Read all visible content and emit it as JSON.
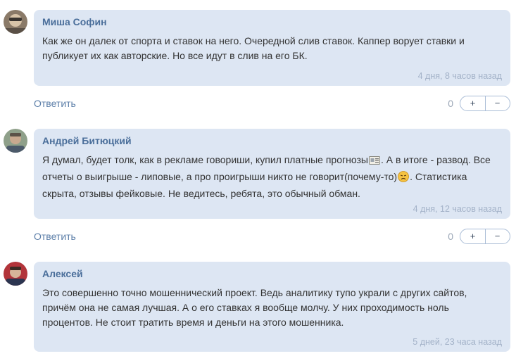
{
  "comments": [
    {
      "author": "Миша Софин",
      "text": "Как же он далек от спорта и ставок на него. Очередной слив ставок. Каппер ворует ставки и публикует их как авторские. Но все идут в слив на его БК.",
      "time": "4 дня, 8 часов назад",
      "score": "0"
    },
    {
      "author": "Андрей Битюцкий",
      "text_part1": "Я думал, будет толк, как в рекламе говориши, купил платные прогнозы",
      "text_part2": ". А в итоге - развод. Все отчеты о выигрыше - липовые, а про проигрыши никто не говорит(почему-то)",
      "text_part3": ". Статистика скрыта, отзывы фейковые. Не ведитесь, ребята, это обычный обман.",
      "time": "4 дня, 12 часов назад",
      "score": "0"
    },
    {
      "author": "Алексей",
      "text": "Это совершенно точно мошеннический проект. Ведь аналитику тупо украли с других сайтов, причём она не самая лучшая. А о его ставках я вообще молчу. У них проходимость ноль процентов. Не стоит тратить время и деньги на этого мошенника.",
      "time": "5 дней, 23 часа назад"
    }
  ],
  "actions": {
    "reply_label": "Ответить",
    "plus_label": "+",
    "minus_label": "−"
  },
  "colors": {
    "bubble": "#dde6f3",
    "author": "#4a6e9a",
    "time": "#a3b2c8",
    "reply": "#5b7ea8"
  },
  "icons": [
    "newspaper-emoji-icon",
    "disappointed-face-emoji-icon"
  ]
}
